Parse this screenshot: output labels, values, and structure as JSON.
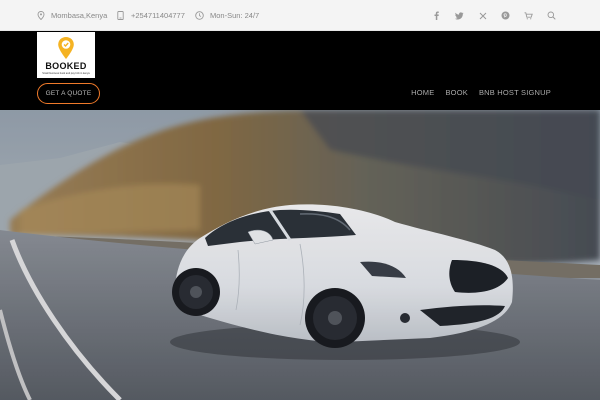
{
  "topbar": {
    "location": "Mombasa,Kenya",
    "phone": "+254711404777",
    "hours": "Mon-Sun: 24/7",
    "social_icons": [
      "facebook-icon",
      "twitter-icon",
      "x-icon",
      "pinterest-icon",
      "cart-icon",
      "search-icon"
    ]
  },
  "header": {
    "logo": {
      "brand": "BOOKED",
      "tagline": "Small business book and pay bnb in kenya"
    },
    "quote_label": "GET A QUOTE",
    "nav": [
      {
        "label": "HOME"
      },
      {
        "label": "BOOK"
      },
      {
        "label": "BNB HOST SIGNUP"
      }
    ]
  },
  "colors": {
    "accent": "#f07a2a",
    "logo_yellow": "#f5b323",
    "topbar_bg": "#f4f4f4",
    "header_bg": "#000000"
  }
}
